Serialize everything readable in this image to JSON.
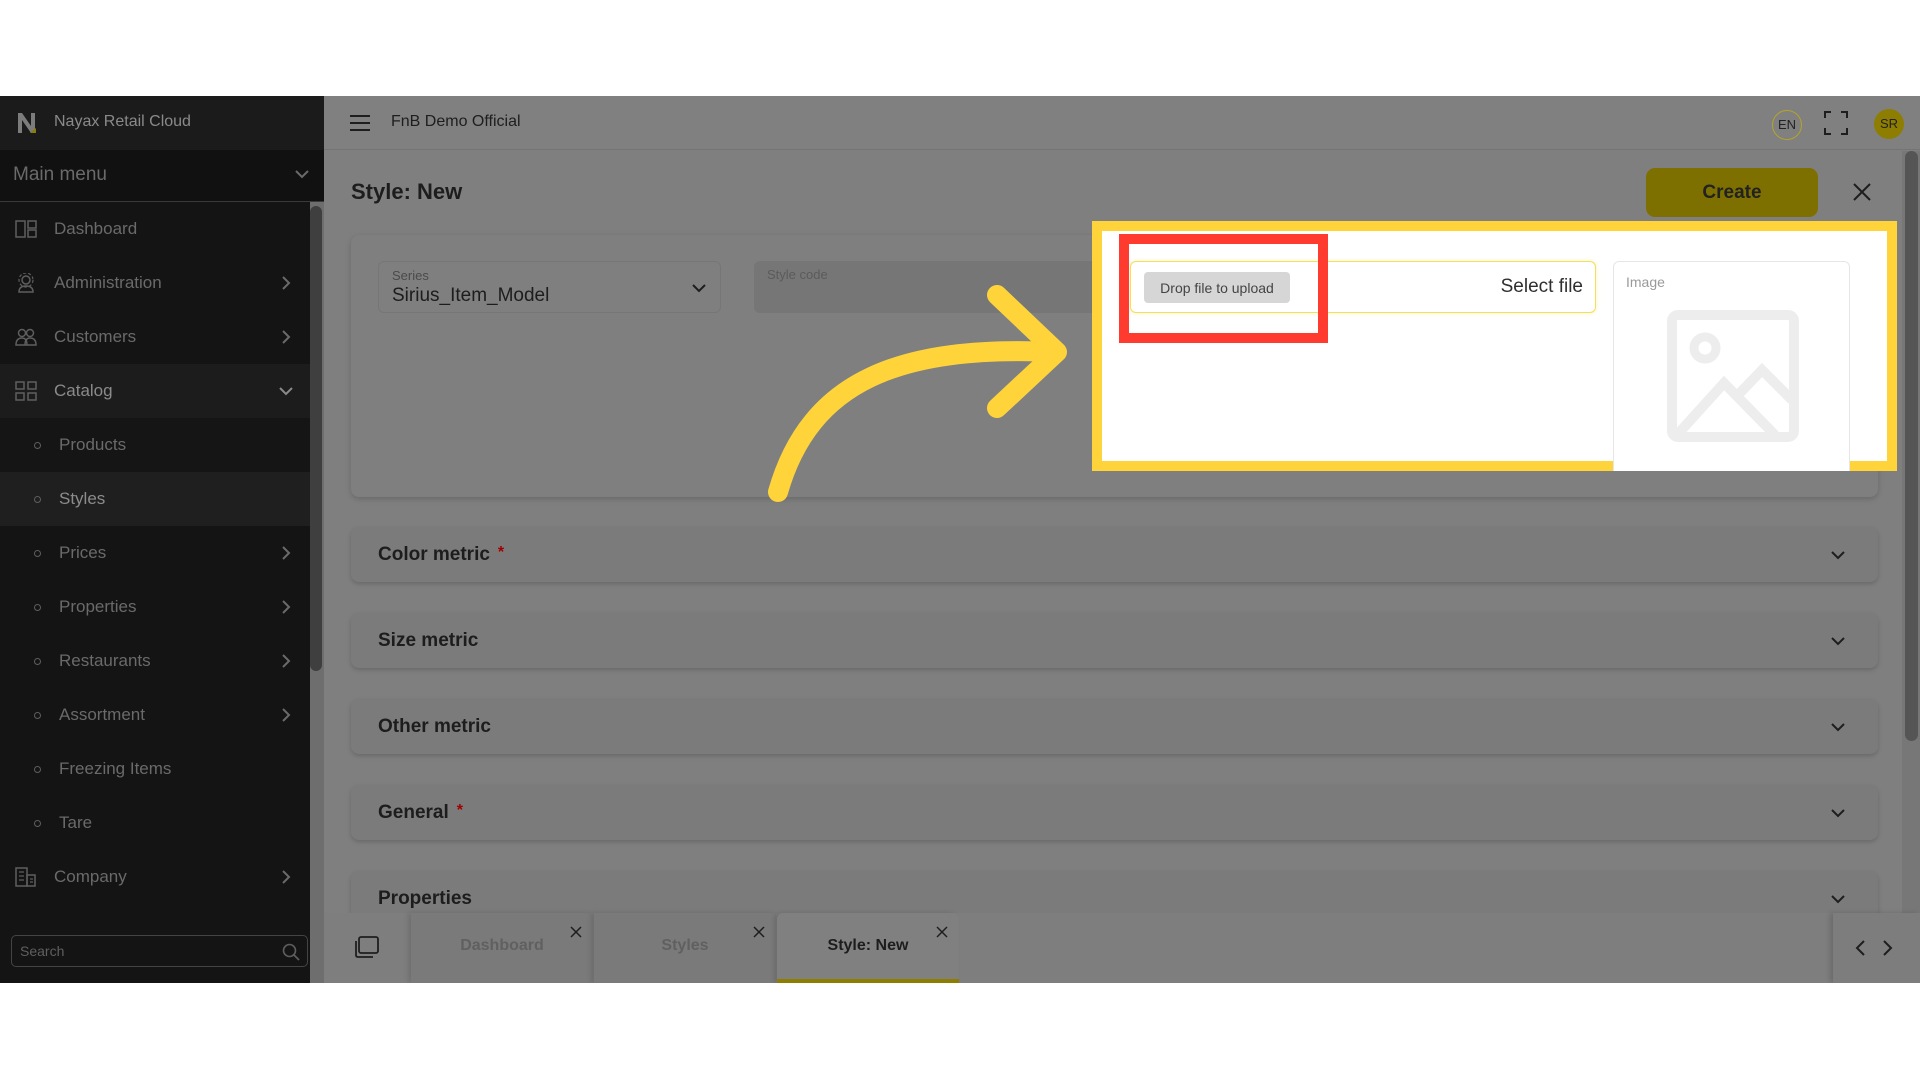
{
  "app": {
    "brand": "Nayax Retail Cloud",
    "organization": "FnB Demo Official",
    "language": "EN",
    "user_initials": "SR"
  },
  "sidebar": {
    "menu_title": "Main menu",
    "items": [
      {
        "label": "Dashboard",
        "icon": "dashboard-icon"
      },
      {
        "label": "Administration",
        "icon": "admin-gear-user-icon",
        "has_children": true
      },
      {
        "label": "Customers",
        "icon": "customers-icon",
        "has_children": true
      },
      {
        "label": "Catalog",
        "icon": "catalog-grid-icon",
        "expanded": true
      },
      {
        "label": "Products",
        "sub": true
      },
      {
        "label": "Styles",
        "sub": true,
        "active": true
      },
      {
        "label": "Prices",
        "sub": true,
        "has_children": true
      },
      {
        "label": "Properties",
        "sub": true,
        "has_children": true
      },
      {
        "label": "Restaurants",
        "sub": true,
        "has_children": true
      },
      {
        "label": "Assortment",
        "sub": true,
        "has_children": true
      },
      {
        "label": "Freezing Items",
        "sub": true
      },
      {
        "label": "Tare",
        "sub": true
      },
      {
        "label": "Company",
        "icon": "company-building-icon",
        "has_children": true
      }
    ],
    "search_placeholder": "Search"
  },
  "page": {
    "title": "Style: New",
    "create_label": "Create",
    "form": {
      "series_label": "Series",
      "series_value": "Sirius_Item_Model",
      "style_code_label": "Style code",
      "style_code_value": "",
      "upload_drop_label": "Drop file to upload",
      "upload_select_label": "Select file",
      "image_label": "Image"
    },
    "sections": [
      {
        "title": "Color metric",
        "required": "*"
      },
      {
        "title": "Size metric",
        "required": ""
      },
      {
        "title": "Other metric",
        "required": ""
      },
      {
        "title": "General",
        "required": "*"
      },
      {
        "title": "Properties",
        "required": ""
      }
    ]
  },
  "tabs": [
    {
      "label": "Dashboard",
      "active": false
    },
    {
      "label": "Styles",
      "active": false
    },
    {
      "label": "Style: New",
      "active": true
    }
  ],
  "annotations": {
    "highlight_color": "#ffd43b",
    "focus_box_color": "#ff3b30",
    "arrow_color": "#ffd43b"
  },
  "colors": {
    "accent": "#8d7d00",
    "sidebar_bg": "#141414",
    "overlay_bg": "#7f7f7f"
  }
}
